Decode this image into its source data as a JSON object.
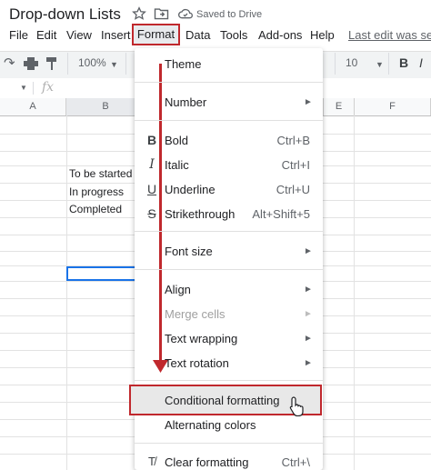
{
  "title_bar": {
    "doc_title": "Drop-down Lists",
    "status": "Saved to Drive"
  },
  "menu_bar": {
    "items": [
      "File",
      "Edit",
      "View",
      "Insert",
      "Format",
      "Data",
      "Tools",
      "Add-ons",
      "Help"
    ],
    "last_edit": "Last edit was sec"
  },
  "toolbar": {
    "zoom": "100%",
    "font_size": "10",
    "bold": "B"
  },
  "formula_bar": {
    "fx": "fx"
  },
  "grid": {
    "columns": [
      "A",
      "B",
      "E",
      "F"
    ],
    "cells": [
      "To be started",
      "In progress",
      "Completed"
    ]
  },
  "format_menu": {
    "theme": "Theme",
    "number": "Number",
    "bold": "Bold",
    "bold_sc": "Ctrl+B",
    "italic": "Italic",
    "italic_sc": "Ctrl+I",
    "underline": "Underline",
    "underline_sc": "Ctrl+U",
    "strikethrough": "Strikethrough",
    "strikethrough_sc": "Alt+Shift+5",
    "font_size": "Font size",
    "align": "Align",
    "merge_cells": "Merge cells",
    "text_wrapping": "Text wrapping",
    "text_rotation": "Text rotation",
    "conditional_formatting": "Conditional formatting",
    "alternating_colors": "Alternating colors",
    "clear_formatting": "Clear formatting",
    "clear_formatting_sc": "Ctrl+\\"
  },
  "colors": {
    "annotation_red": "#c0282d",
    "selection_blue": "#1a73e8"
  }
}
